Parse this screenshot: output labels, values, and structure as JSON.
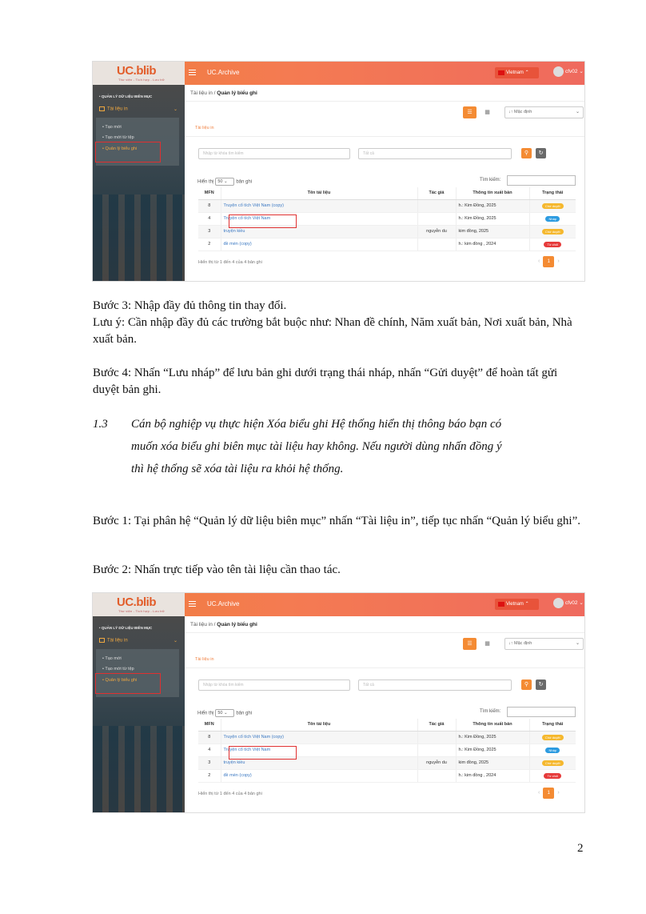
{
  "screenshot": {
    "logo": "UC.blib",
    "logo_sub": "Thư viện - Tích hợp - Lưu trữ",
    "app_title": "UC.Archive",
    "language": "Vietnam",
    "user": "cfv02",
    "sidebar": {
      "section": "QUẢN LÝ DỮ LIỆU BIÊN MỤC",
      "group": "Tài liệu in",
      "items": [
        "Tạo mới",
        "Tạo mới từ tệp",
        "Quản lý biểu ghi"
      ]
    },
    "breadcrumb": {
      "parent": "Tài liệu in",
      "sep": "/",
      "current": "Quản lý biểu ghi"
    },
    "sort_label": "Mặc định",
    "tab": "Tài liệu in",
    "search_placeholder": "Nhập từ khóa tìm kiếm",
    "search_placeholder2": "Tất cả",
    "show_label": "Hiển thị",
    "show_value": "50",
    "show_suffix": "bản ghi",
    "find_label": "Tìm kiếm:",
    "columns": [
      "MFN",
      "Tên tài liệu",
      "Tác giả",
      "Thông tin xuất bản",
      "Trạng thái"
    ],
    "rows": [
      {
        "mfn": "8",
        "title": "Truyện cổ tích Việt Nam (copy)",
        "author": "",
        "pub": "h.: Kim Đồng, 2025",
        "status": "Chờ duyệt"
      },
      {
        "mfn": "4",
        "title": "Truyện cổ tích Việt Nam",
        "author": "",
        "pub": "h.: Kim Đồng, 2025",
        "status": "Nháp"
      },
      {
        "mfn": "3",
        "title": "truyện kiều",
        "author": "nguyễn du",
        "pub": "kim đồng, 2025",
        "status": "Chờ duyệt"
      },
      {
        "mfn": "2",
        "title": "đề mèn (copy)",
        "author": "",
        "pub": "h.: kim đồng , 2024",
        "status": "Từ chối"
      }
    ],
    "info": "Hiển thị từ 1 đến 4 của 4 bản ghi",
    "page": "1",
    "status_colors": {
      "Chờ duyệt": "#f5b82e",
      "Nháp": "#2c9be0",
      "Từ chối": "#e63b3b"
    }
  },
  "text": {
    "p1": "Bước 3: Nhập đầy đủ thông tin thay đổi.",
    "p2": "Lưu ý: Cần nhập đầy đủ các trường bắt buộc như: Nhan đề chính, Năm xuất bản, Nơi xuất bản, Nhà xuất bản.",
    "p3": "Bước 4: Nhấn “Lưu nháp” để lưu bản ghi dưới trạng thái nháp, nhấn “Gửi duyệt” để hoàn tất gửi duyệt bản ghi.",
    "section_num": "1.3",
    "section_l1": "Cán bộ nghiệp vụ thực hiện Xóa biểu ghi Hệ thống hiển thị thông báo bạn có",
    "section_l2": "muốn xóa biểu ghi biên mục tài liệu hay không. Nếu người dùng nhấn đồng ý",
    "section_l3": "thì hệ thống sẽ xóa tài liệu ra khỏi hệ thống.",
    "p4": "Bước 1: Tại phân hệ “Quản lý dữ liệu biên mục” nhấn “Tài liệu in”, tiếp tục nhấn “Quản lý biểu ghi”.",
    "p5": "Bước 2: Nhấn trực tiếp vào tên tài liệu cần thao tác.",
    "page_number": "2"
  }
}
